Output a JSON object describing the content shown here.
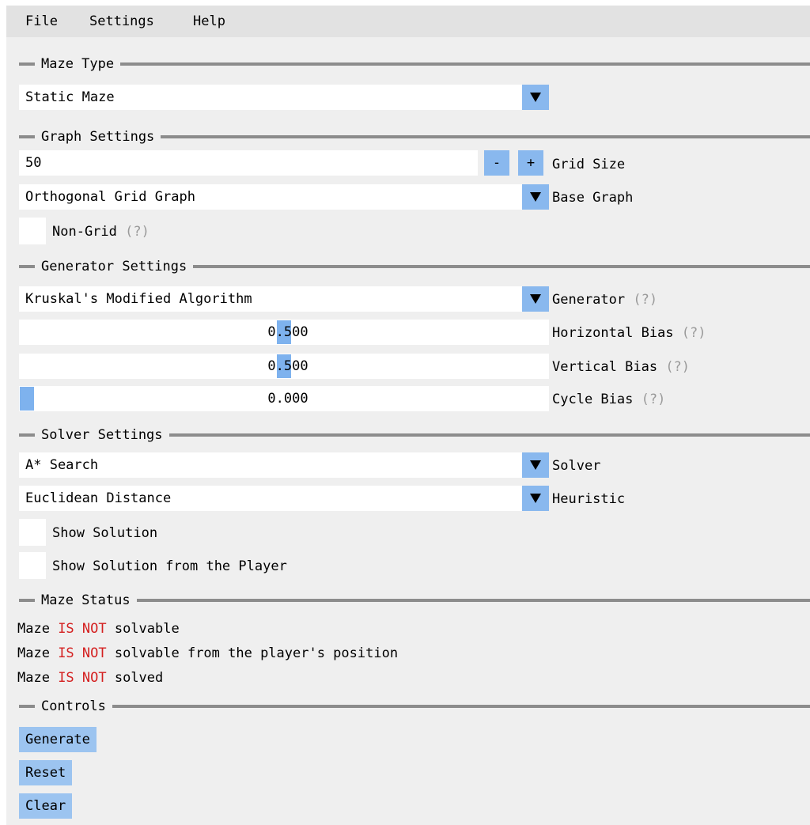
{
  "menu": {
    "file": "File",
    "settings": "Settings",
    "help": "Help"
  },
  "maze_type": {
    "section": "Maze Type",
    "selected": "Static Maze"
  },
  "graph": {
    "section": "Graph Settings",
    "grid_size_value": "50",
    "minus_label": "-",
    "plus_label": "+",
    "grid_size_label": "Grid Size",
    "base_graph_selected": "Orthogonal Grid Graph",
    "base_graph_label": "Base Graph",
    "non_grid_label": "Non-Grid",
    "non_grid_hint": "(?)",
    "non_grid_checked": false
  },
  "generator": {
    "section": "Generator Settings",
    "selected": "Kruskal's Modified Algorithm",
    "label": "Generator",
    "hint": "(?)",
    "horizontal_bias": {
      "value": "0.500",
      "fraction": 0.5,
      "label": "Horizontal Bias",
      "hint": "(?)"
    },
    "vertical_bias": {
      "value": "0.500",
      "fraction": 0.5,
      "label": "Vertical Bias",
      "hint": "(?)"
    },
    "cycle_bias": {
      "value": "0.000",
      "fraction": 0.0,
      "label": "Cycle Bias",
      "hint": "(?)"
    }
  },
  "solver": {
    "section": "Solver Settings",
    "selected": "A* Search",
    "label": "Solver",
    "heuristic_selected": "Euclidean Distance",
    "heuristic_label": "Heuristic",
    "show_solution_label": "Show Solution",
    "show_solution_checked": false,
    "show_solution_player_label": "Show Solution from the Player",
    "show_solution_player_checked": false
  },
  "status": {
    "section": "Maze Status",
    "lines": [
      {
        "prefix": "Maze ",
        "flag": "IS NOT",
        "suffix": " solvable"
      },
      {
        "prefix": "Maze ",
        "flag": "IS NOT",
        "suffix": " solvable from the player's position"
      },
      {
        "prefix": "Maze ",
        "flag": "IS NOT",
        "suffix": " solved"
      }
    ]
  },
  "controls": {
    "section": "Controls",
    "generate": "Generate",
    "reset": "Reset",
    "clear": "Clear"
  },
  "colors": {
    "accent": "#89b8ee",
    "panel": "#efefef",
    "status_flag": "#d42020",
    "hint": "#9a9a9a"
  },
  "icons": {
    "dropdown": "triangle-down-icon"
  }
}
